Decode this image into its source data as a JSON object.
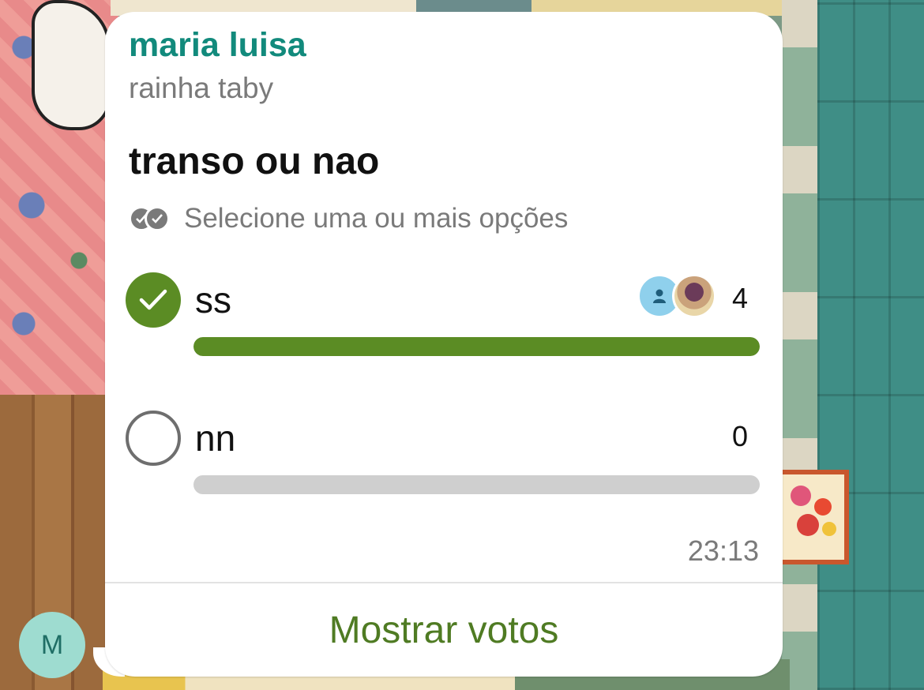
{
  "message": {
    "sender_name": "maria luisa",
    "author_line": "rainha taby",
    "avatar_initial": "M",
    "time": "23:13"
  },
  "poll": {
    "question": "transo ou nao",
    "hint": "Selecione uma ou mais opções",
    "options": [
      {
        "label": "ss",
        "votes": "4",
        "selected": true,
        "fill_fraction": 1.0
      },
      {
        "label": "nn",
        "votes": "0",
        "selected": false,
        "fill_fraction": 0.0
      }
    ],
    "show_votes_label": "Mostrar votos"
  },
  "colors": {
    "accent_green": "#5b8c24",
    "sender_teal": "#128a7c",
    "muted_gray": "#7a7a7a"
  }
}
